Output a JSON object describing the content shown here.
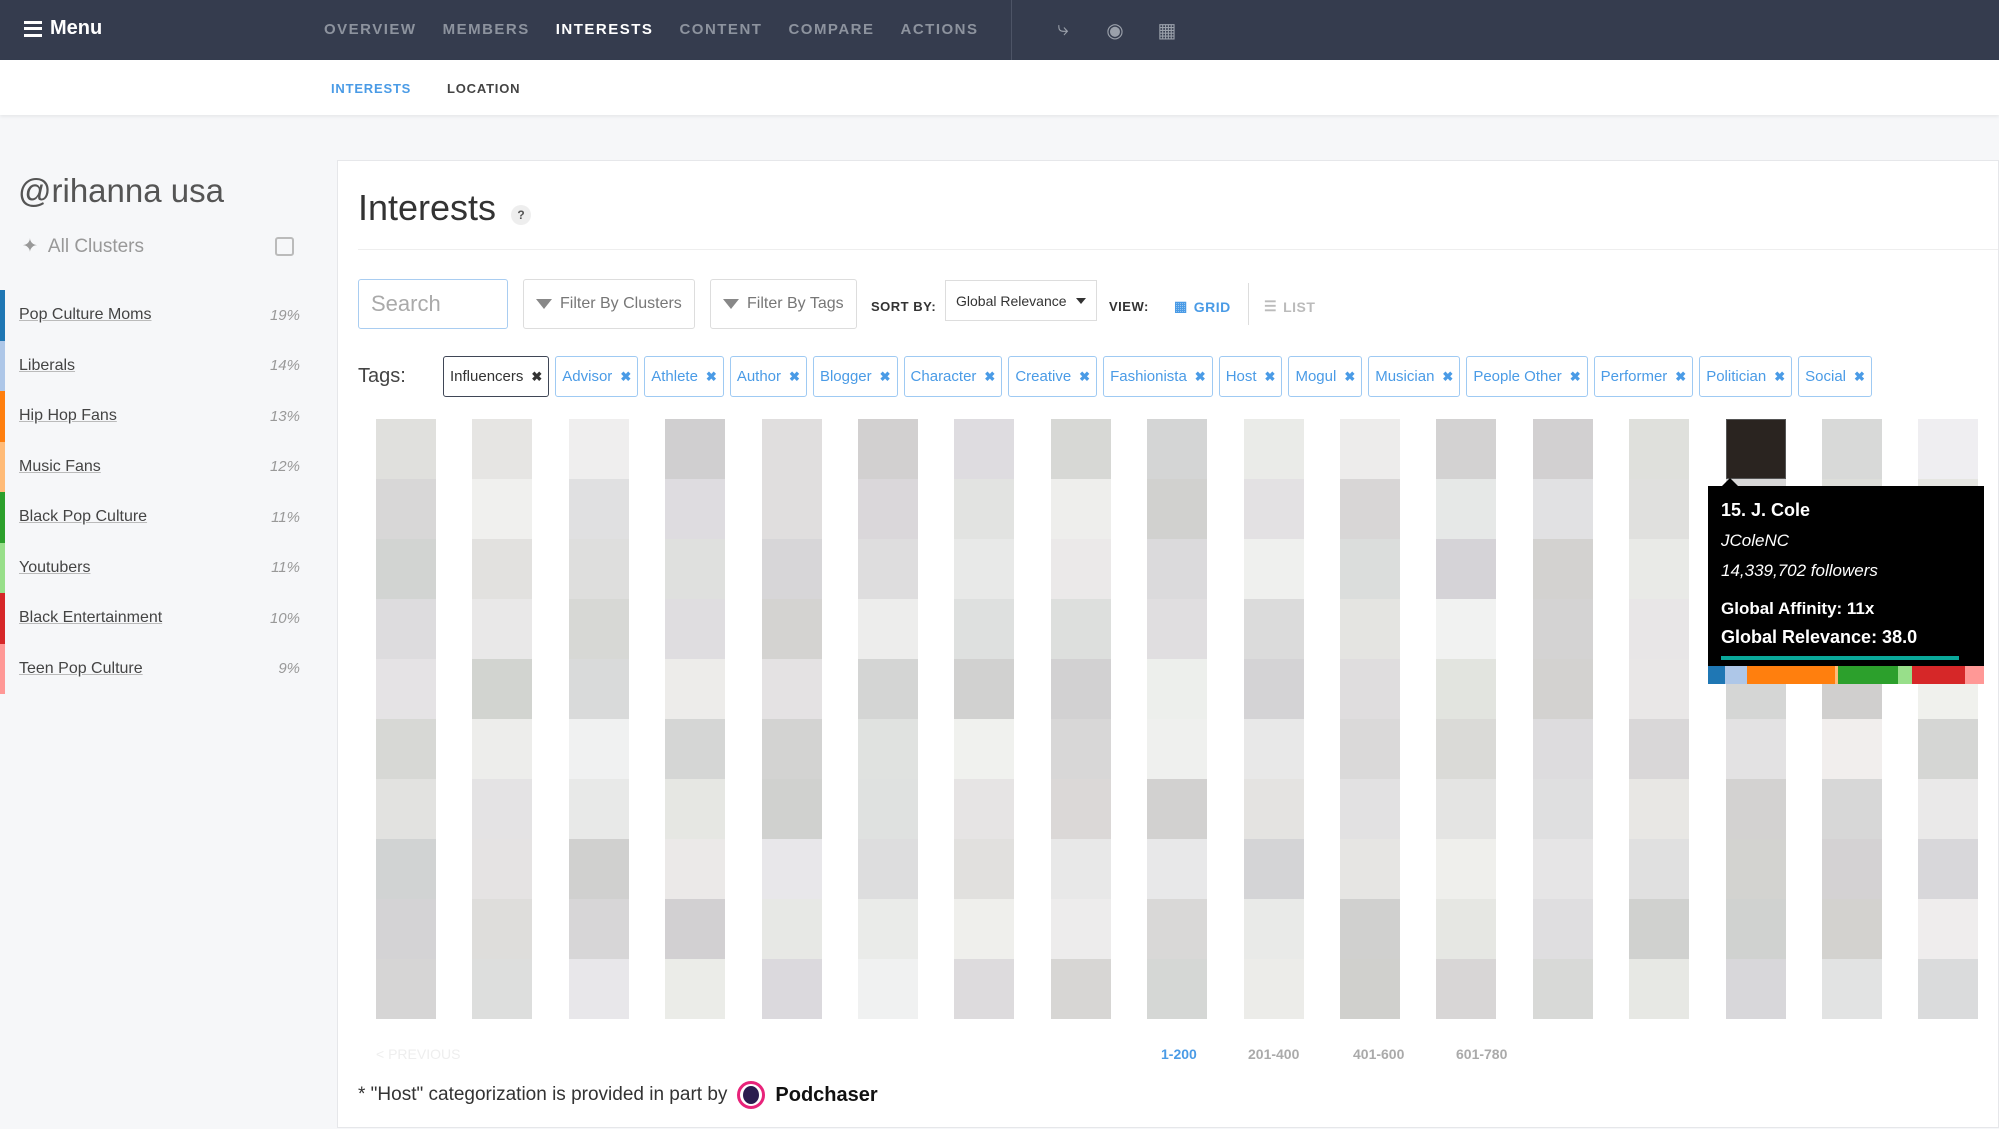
{
  "nav": {
    "menu_label": "Menu",
    "tabs": [
      "OVERVIEW",
      "MEMBERS",
      "INTERESTS",
      "CONTENT",
      "COMPARE",
      "ACTIONS"
    ],
    "active_tab": "INTERESTS",
    "icons": [
      "share-icon",
      "camera-icon",
      "bar-chart-icon"
    ]
  },
  "subnav": {
    "tabs": [
      "INTERESTS",
      "LOCATION"
    ],
    "active_tab": "INTERESTS",
    "active_color": "#4a9be6"
  },
  "sidebar": {
    "handle": "@rihanna usa",
    "all_clusters": "All Clusters",
    "clusters": [
      {
        "name": "Pop Culture Moms",
        "pct": "19%",
        "color": "#1f77b4"
      },
      {
        "name": "Liberals",
        "pct": "14%",
        "color": "#aec7e8"
      },
      {
        "name": "Hip Hop Fans",
        "pct": "13%",
        "color": "#ff7f0e"
      },
      {
        "name": "Music Fans",
        "pct": "12%",
        "color": "#ffbb78"
      },
      {
        "name": "Black Pop Culture",
        "pct": "11%",
        "color": "#2ca02c"
      },
      {
        "name": "Youtubers",
        "pct": "11%",
        "color": "#98df8a"
      },
      {
        "name": "Black Entertainment",
        "pct": "10%",
        "color": "#d62728"
      },
      {
        "name": "Teen Pop Culture",
        "pct": "9%",
        "color": "#ff9896"
      }
    ]
  },
  "main": {
    "title": "Interests",
    "help": "?",
    "search_placeholder": "Search",
    "filter_clusters": "Filter By Clusters",
    "filter_tags": "Filter By Tags",
    "sort_label": "SORT BY:",
    "sort_value": "Global Relevance",
    "view_label": "VIEW:",
    "view_grid": "GRID",
    "view_list": "LIST",
    "active_view": "GRID",
    "tags_label": "Tags:",
    "tags": [
      "Influencers",
      "Advisor",
      "Athlete",
      "Author",
      "Blogger",
      "Character",
      "Creative",
      "Fashionista",
      "Host",
      "Mogul",
      "Musician",
      "People Other",
      "Performer",
      "Politician",
      "Social"
    ],
    "tooltip": {
      "title": "15. J. Cole",
      "handle": "JColeNC",
      "followers": "14,339,702 followers",
      "affinity": "Global Affinity: 11x",
      "relevance": "Global Relevance: 38.0",
      "relevance_value": 38.0,
      "cluster_segments": [
        [
          "#1f77b4",
          0.06
        ],
        [
          "#aec7e8",
          0.08
        ],
        [
          "#ff7f0e",
          0.32
        ],
        [
          "#ffbb78",
          0.01
        ],
        [
          "#2ca02c",
          0.22
        ],
        [
          "#98df8a",
          0.05
        ],
        [
          "#d62728",
          0.19
        ],
        [
          "#ff9896",
          0.07
        ]
      ]
    },
    "pagination": {
      "previous": "< PREVIOUS",
      "pages": [
        "1-200",
        "201-400",
        "401-600",
        "601-780"
      ],
      "active": "1-200"
    },
    "footer": {
      "note": "* \"Host\" categorization is provided in part by",
      "brand": "Podchaser"
    }
  }
}
